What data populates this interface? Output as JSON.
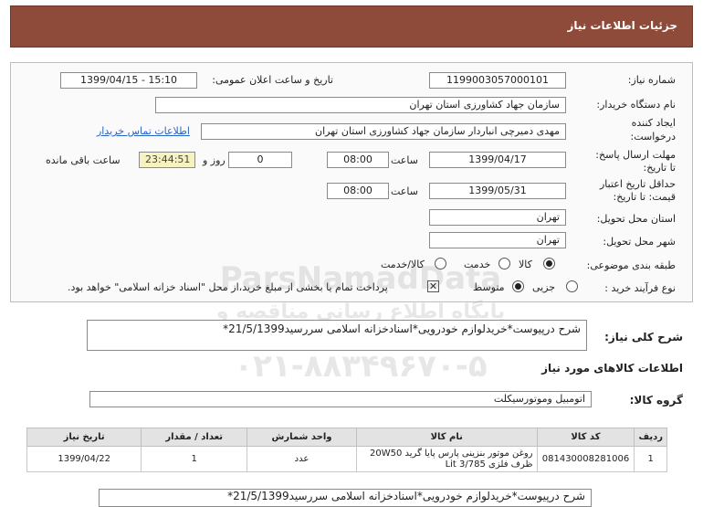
{
  "header": {
    "title": "جزئیات اطلاعات نیاز"
  },
  "form": {
    "need_number_label": "شماره نیاز:",
    "need_number": "1199003057000101",
    "announce_label": "تاریخ و ساعت اعلان عمومی:",
    "announce_value": "1399/04/15 - 15:10",
    "buyer_org_label": "نام دستگاه خریدار:",
    "buyer_org": "سازمان جهاد کشاورزی استان تهران",
    "requester_label_1": "ایجاد کننده",
    "requester_label_2": "درخواست:",
    "requester": "مهدی  دمیرچی انباردار سازمان جهاد کشاورزی استان تهران",
    "contact_link": "اطلاعات تماس خریدار",
    "deadline_label_1": "مهلت ارسال پاسخ:",
    "deadline_label_2": "تا تاریخ:",
    "deadline_date": "1399/04/17",
    "time_label": "ساعت",
    "deadline_time": "08:00",
    "days_value": "0",
    "days_label": "روز و",
    "countdown": "23:44:51",
    "remaining_label": "ساعت باقی مانده",
    "validity_label_1": "حداقل تاریخ اعتبار",
    "validity_label_2": "قیمت: تا تاریخ:",
    "validity_date": "1399/05/31",
    "validity_time_label": "ساعت",
    "validity_time": "08:00",
    "province_label": "استان محل تحویل:",
    "province": "تهران",
    "city_label": "شهر محل تحویل:",
    "city": "تهران",
    "category_label": "طبقه بندی موضوعی:",
    "category_options": [
      "کالا",
      "خدمت",
      "کالا/خدمت"
    ],
    "process_label": "نوع فرآیند خرید :",
    "process_options": [
      "جزیی",
      "متوسط"
    ],
    "payment_note": "پرداخت تمام یا بخشی از مبلغ خرید،از محل \"اسناد خزانه اسلامی\" خواهد بود."
  },
  "description": {
    "label": "شرح کلی نیاز:",
    "text": "شرح درپیوست*خریدلوازم خودرویی*اسنادخزانه اسلامی سررسید21/5/1399*"
  },
  "goods": {
    "section_title": "اطلاعات کالاهای مورد نیاز",
    "group_label": "گروه کالا:",
    "group_value": "اتومبیل وموتورسیکلت",
    "columns": [
      "ردیف",
      "کد کالا",
      "نام کالا",
      "واحد شمارش",
      "تعداد / مقدار",
      "تاریخ نیاز"
    ],
    "rows": [
      {
        "row": "1",
        "code": "081430008281006",
        "name": "روغن موتور بنزینی پارس پایا گرید 20W50 ظرف فلزی 3/785 Lit",
        "unit": "عدد",
        "qty": "1",
        "date": "1399/04/22"
      }
    ],
    "bottom_desc": "شرح درپیوست*خریدلوازم خودرویی*اسنادخزانه اسلامی سررسید21/5/1399*"
  },
  "watermark": {
    "line1": "ParsNamadData",
    "line2": "پایگاه اطلاع رسانی مناقصه و مزایده",
    "line3": "۰۲۱-۸۸۳۴۹۶۷۰-۵"
  }
}
